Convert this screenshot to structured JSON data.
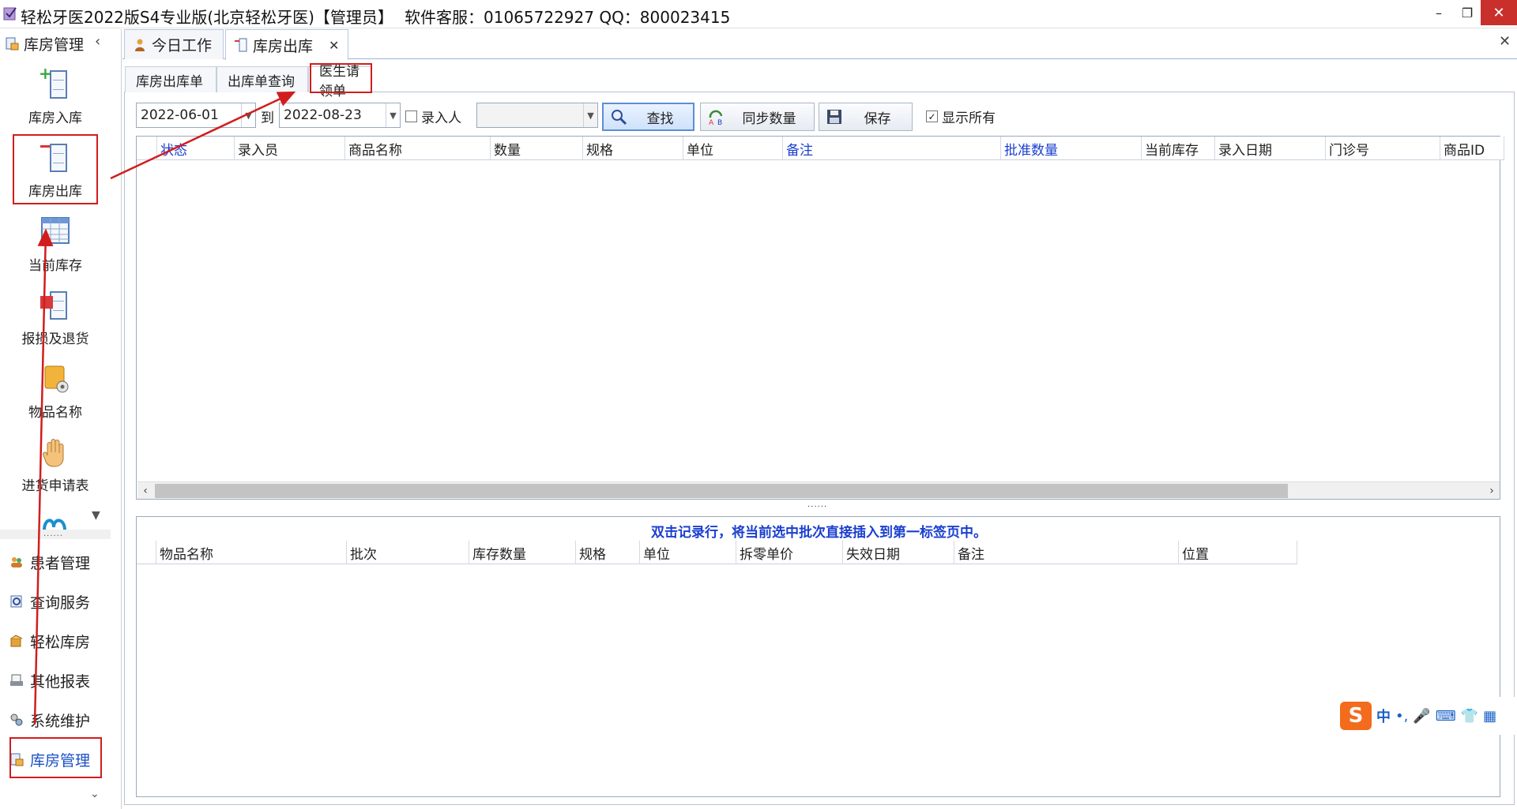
{
  "window": {
    "title": "轻松牙医2022版S4专业版(北京轻松牙医)【管理员】",
    "support": "软件客服：01065722927 QQ：800023415",
    "minimize": "–",
    "restore": "❐",
    "close": "✕"
  },
  "nav": {
    "header": "库房管理",
    "collapse": "‹",
    "items": [
      {
        "label": "库房入库",
        "icon": "stock-in-icon"
      },
      {
        "label": "库房出库",
        "icon": "stock-out-icon"
      },
      {
        "label": "当前库存",
        "icon": "inventory-table-icon"
      },
      {
        "label": "报损及退货",
        "icon": "damage-return-icon"
      },
      {
        "label": "物品名称",
        "icon": "item-names-icon"
      },
      {
        "label": "进货申请表",
        "icon": "hand-icon"
      }
    ],
    "more_caret": "▼",
    "splitter": "......",
    "modules": [
      {
        "label": "患者管理",
        "icon": "patients-icon"
      },
      {
        "label": "查询服务",
        "icon": "query-icon"
      },
      {
        "label": "轻松库房",
        "icon": "warehouse-icon"
      },
      {
        "label": "其他报表",
        "icon": "reports-icon"
      },
      {
        "label": "系统维护",
        "icon": "maintenance-icon"
      },
      {
        "label": "库房管理",
        "icon": "storage-management-icon"
      }
    ],
    "bottom_caret": "⌄"
  },
  "tabs": {
    "today": "今日工作",
    "stock_out": "库房出库",
    "close": "✕",
    "bar_close": "✕"
  },
  "subtabs": [
    "库房出库单",
    "出库单查询",
    "医生请领单"
  ],
  "toolbar": {
    "date_from": "2022-06-01",
    "to_label": "到",
    "date_to": "2022-08-23",
    "entry_person_label": "录入人",
    "entry_person_value": "",
    "search": "查找",
    "sync": "同步数量",
    "save": "保存",
    "show_all_label": "显示所有",
    "show_all_checked": true
  },
  "grid1": {
    "columns": [
      "状态",
      "录入员",
      "商品名称",
      "数量",
      "规格",
      "单位",
      "备注",
      "批准数量",
      "当前库存",
      "录入日期",
      "门诊号",
      "商品ID"
    ],
    "rows": []
  },
  "splitter_dots": "......",
  "grid2": {
    "caption": "双击记录行，将当前选中批次直接插入到第一标签页中。",
    "columns": [
      "物品名称",
      "批次",
      "库存数量",
      "规格",
      "单位",
      "拆零单价",
      "失效日期",
      "备注",
      "位置"
    ],
    "rows": []
  },
  "ime": {
    "logo": "S",
    "mode": "中",
    "punct": "•,",
    "mic": "🎤",
    "keyboard": "⌨",
    "skin": "👕",
    "apps": "▦"
  },
  "colors": {
    "accent": "#1a3fd0",
    "annotation": "#d21d1d",
    "ime_orange": "#f36b1c"
  }
}
